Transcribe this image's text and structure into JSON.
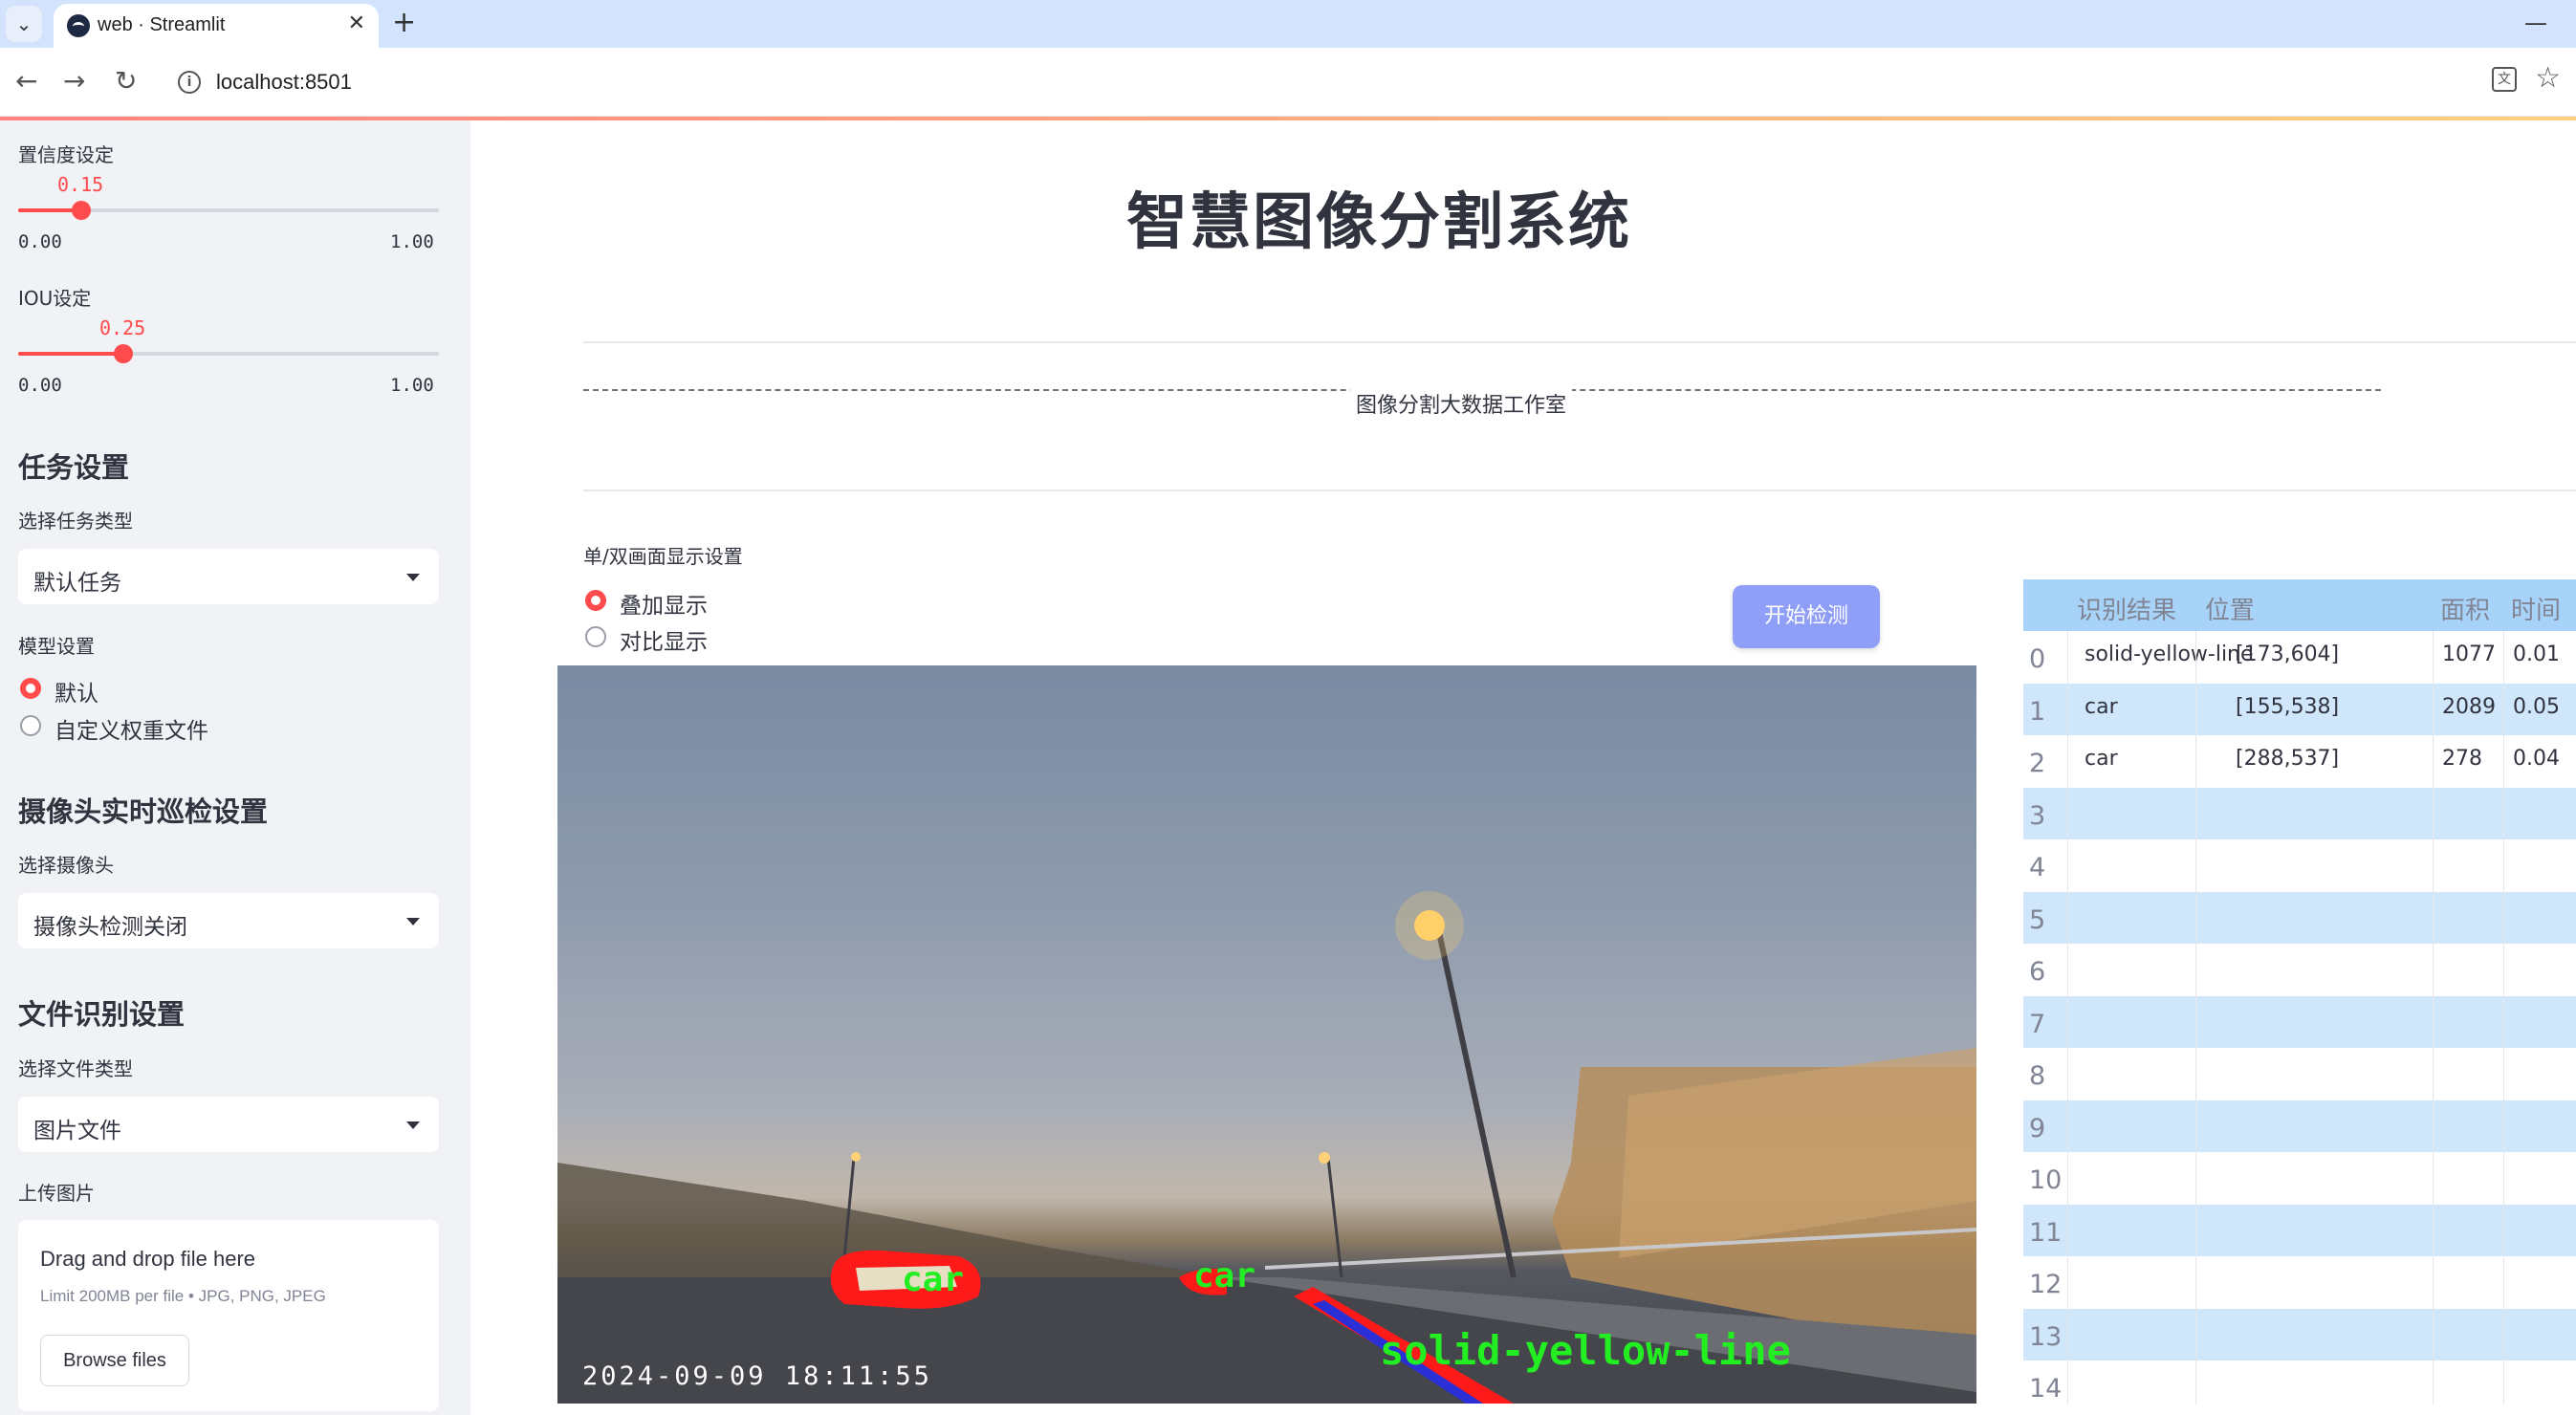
{
  "browser": {
    "tab_title": "web · Streamlit",
    "url": "localhost:8501",
    "new_tab": "+",
    "close": "✕",
    "minimize": "—"
  },
  "sidebar": {
    "confidence": {
      "label": "置信度设定",
      "value": "0.15",
      "value_num": 0.15,
      "min": "0.00",
      "max": "1.00"
    },
    "iou": {
      "label": "IOU设定",
      "value": "0.25",
      "value_num": 0.25,
      "min": "0.00",
      "max": "1.00"
    },
    "task_header": "任务设置",
    "task_type_label": "选择任务类型",
    "task_type_value": "默认任务",
    "model_label": "模型设置",
    "model_options": [
      "默认",
      "自定义权重文件"
    ],
    "model_selected": "默认",
    "camera_header": "摄像头实时巡检设置",
    "camera_label": "选择摄像头",
    "camera_value": "摄像头检测关闭",
    "file_header": "文件识别设置",
    "file_type_label": "选择文件类型",
    "file_type_value": "图片文件",
    "upload_label": "上传图片",
    "upload_title": "Drag and drop file here",
    "upload_limit": "Limit 200MB per file • JPG, PNG, JPEG",
    "browse_label": "Browse files"
  },
  "main": {
    "title": "智慧图像分割系统",
    "divider_text": "图像分割大数据工作室",
    "display_label": "单/双画面显示设置",
    "display_options": [
      "叠加显示",
      "对比显示"
    ],
    "display_selected": "叠加显示",
    "start_button": "开始检测",
    "image": {
      "timestamp": "2024-09-09  18:11:55",
      "detections": [
        "car",
        "car",
        "solid-yellow-line"
      ]
    }
  },
  "table": {
    "columns": [
      "识别结果",
      "位置",
      "面积",
      "时间"
    ],
    "rows": [
      {
        "index": "0",
        "label": "solid-yellow-line",
        "position": "[173,604]",
        "area": "1077",
        "time": "0.01"
      },
      {
        "index": "1",
        "label": "car",
        "position": "[155,538]",
        "area": "2089",
        "time": "0.05"
      },
      {
        "index": "2",
        "label": "car",
        "position": "[288,537]",
        "area": "278",
        "time": "0.04"
      },
      {
        "index": "3",
        "label": "",
        "position": "",
        "area": "",
        "time": ""
      },
      {
        "index": "4",
        "label": "",
        "position": "",
        "area": "",
        "time": ""
      },
      {
        "index": "5",
        "label": "",
        "position": "",
        "area": "",
        "time": ""
      },
      {
        "index": "6",
        "label": "",
        "position": "",
        "area": "",
        "time": ""
      },
      {
        "index": "7",
        "label": "",
        "position": "",
        "area": "",
        "time": ""
      },
      {
        "index": "8",
        "label": "",
        "position": "",
        "area": "",
        "time": ""
      },
      {
        "index": "9",
        "label": "",
        "position": "",
        "area": "",
        "time": ""
      },
      {
        "index": "10",
        "label": "",
        "position": "",
        "area": "",
        "time": ""
      },
      {
        "index": "11",
        "label": "",
        "position": "",
        "area": "",
        "time": ""
      },
      {
        "index": "12",
        "label": "",
        "position": "",
        "area": "",
        "time": ""
      },
      {
        "index": "13",
        "label": "",
        "position": "",
        "area": "",
        "time": ""
      },
      {
        "index": "14",
        "label": "",
        "position": "",
        "area": "",
        "time": ""
      }
    ]
  },
  "colors": {
    "accent": "#ff4b4b",
    "button": "#8f9ef7",
    "table_header": "#a8d3f8",
    "table_stripe": "#cfe6fb",
    "mask": "#ff1a1a",
    "det_text": "#22ee22"
  }
}
